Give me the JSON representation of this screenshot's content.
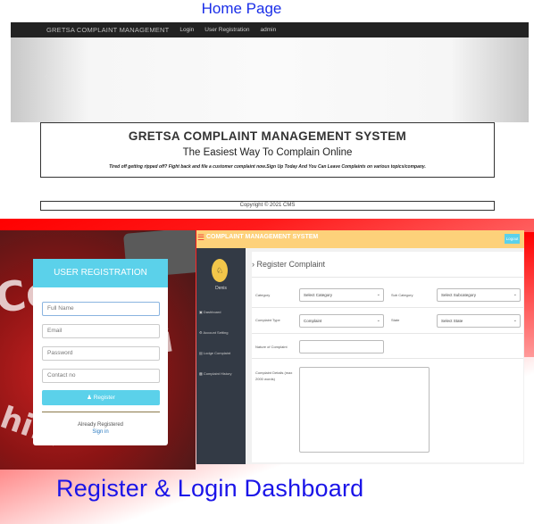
{
  "home_title": "Home Page",
  "navbar": {
    "brand": "GRETSA COMPLAINT MANAGEMENT",
    "links": [
      "Login",
      "User Registration",
      "admin"
    ]
  },
  "hero": {
    "prev": "‹",
    "next": "›"
  },
  "intro": {
    "title": "GRETSA COMPLAINT MANAGEMENT SYSTEM",
    "subtitle": "The Easiest Way To Complain Online",
    "tagline": "Tired off getting ripped off? Fight back and file a customer complaint now.Sign Up Today And You Can Leave Complaints on various topics/company."
  },
  "footer": "Copyright © 2021 CMS",
  "registration": {
    "heading": "USER REGISTRATION",
    "placeholders": {
      "full_name": "Full Name",
      "email": "Email",
      "password": "Password",
      "contact": "Contact no"
    },
    "register_button": "Register",
    "already": "Already Registered",
    "signin": "Sign in"
  },
  "dashboard": {
    "title": "COMPLAINT MANAGEMENT SYSTEM",
    "logout": "Logout",
    "user_name": "Denis",
    "sidebar": [
      "Dashboard",
      "Account Setting",
      "Lodge Complaint",
      "Complaint History"
    ],
    "page_heading": "Register Complaint",
    "form": {
      "category_label": "Category",
      "category_value": "Select Category",
      "subcategory_label": "Sub Category",
      "subcategory_value": "Select Subcategory",
      "complaint_type_label": "Complaint Type",
      "complaint_type_value": "Complaint",
      "state_label": "State",
      "state_value": "Select State",
      "nature_label": "Nature of Complaint",
      "details_label": "Complaint Details (max 2000 words)"
    }
  },
  "bottom_title": "Register & Login Dashboard"
}
